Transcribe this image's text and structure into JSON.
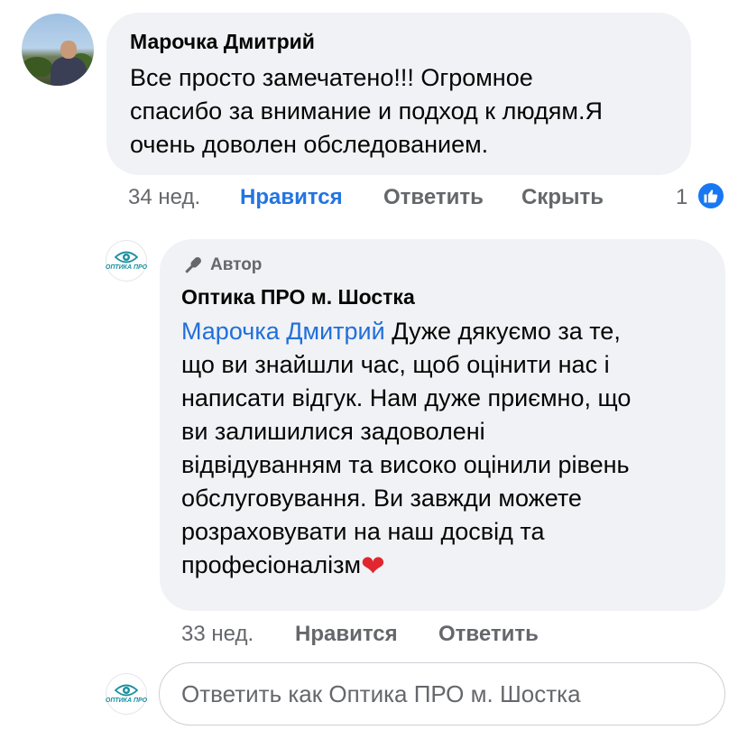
{
  "comment": {
    "author": "Марочка Дмитрий",
    "text_lines": [
      "Все просто замечатено!!! Огромное",
      "спасибо за внимание и подход к людям.Я",
      "очень доволен обследованием."
    ],
    "time": "34 нед.",
    "like_label": "Нравится",
    "reply_label": "Ответить",
    "hide_label": "Скрыть",
    "reaction_count": "1",
    "reaction_icon": "thumbs-up-icon",
    "accent_color": "#2374e1"
  },
  "reply": {
    "avatar_text": "ОПТИКА ПРО",
    "badge_label": "Автор",
    "badge_icon": "microphone-icon",
    "author": "Оптика ПРО м. Шостка",
    "mention": "Марочка Дмитрий",
    "text_first_line_rest": "Дуже дякуємо за те,",
    "text_lines": [
      "що ви знайшли час, щоб оцінити нас і",
      "написати відгук. Нам дуже приємно, що",
      "ви залишилися задоволені",
      "відвідуванням та високо оцінили рівень",
      "обслуговування. Ви завжди можете",
      "розраховувати на наш досвід та"
    ],
    "last_line": "професіоналізм",
    "emoji": "❤",
    "time": "33 нед.",
    "like_label": "Нравится",
    "reply_label": "Ответить"
  },
  "composer": {
    "avatar_text": "ОПТИКА ПРО",
    "placeholder": "Ответить как Оптика ПРО м. Шостка"
  }
}
